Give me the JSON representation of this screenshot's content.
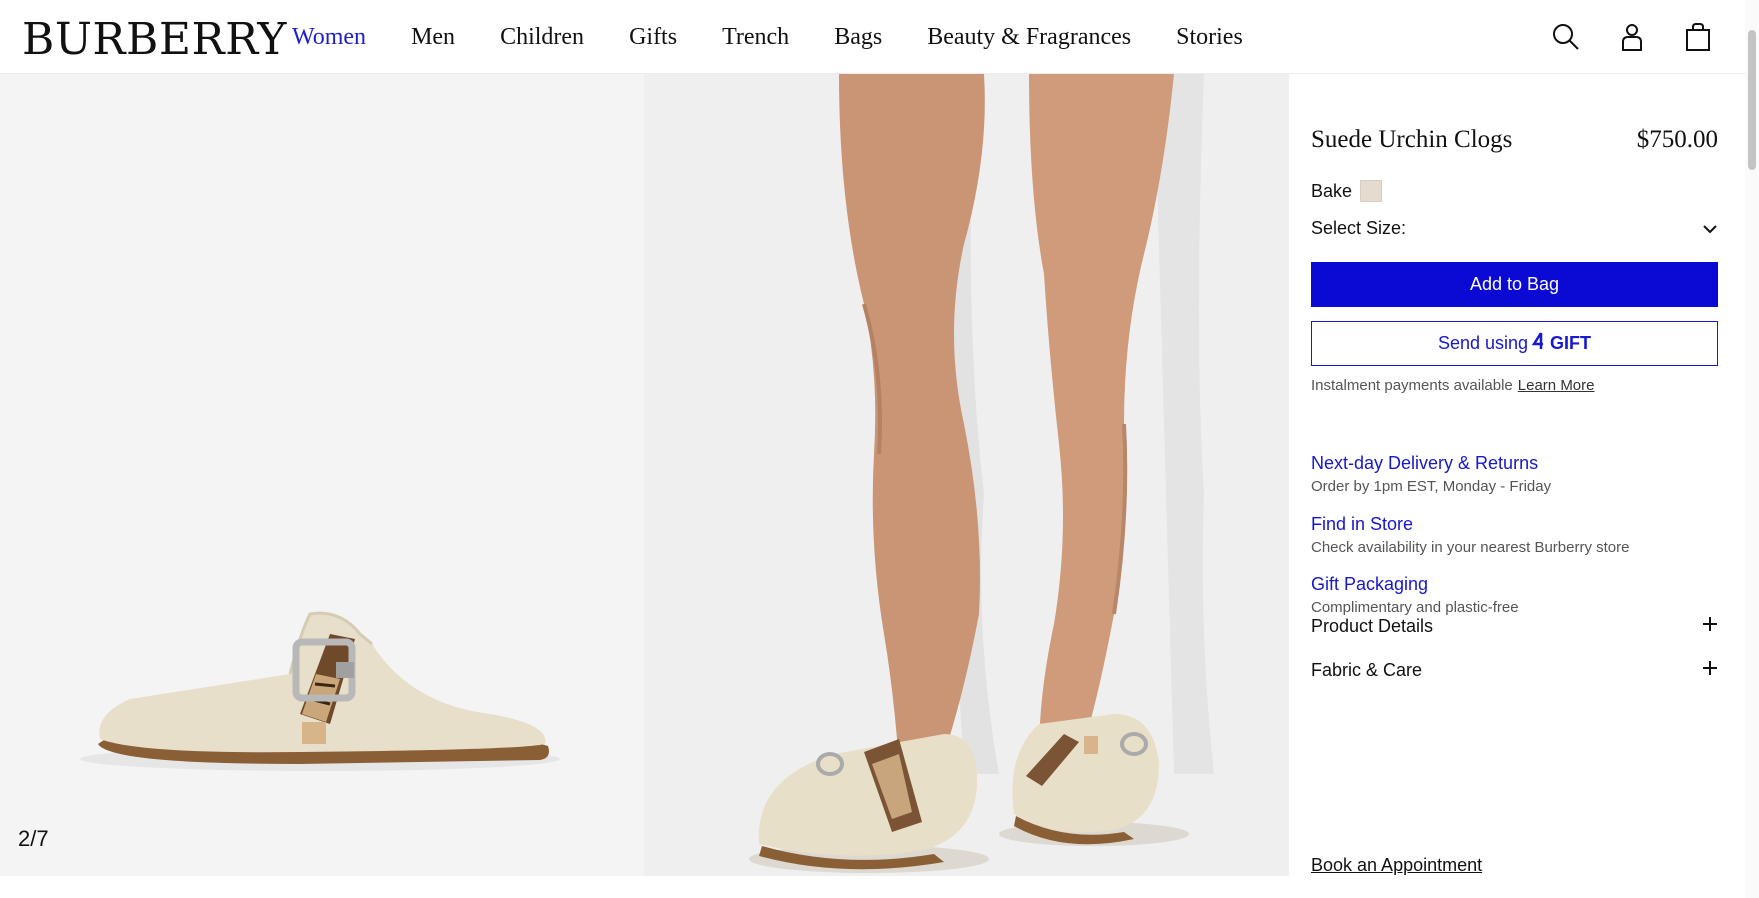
{
  "header": {
    "logo": "BURBERRY",
    "nav": [
      {
        "label": "Women",
        "active": true
      },
      {
        "label": "Men"
      },
      {
        "label": "Children"
      },
      {
        "label": "Gifts"
      },
      {
        "label": "Trench"
      },
      {
        "label": "Bags"
      },
      {
        "label": "Beauty & Fragrances"
      },
      {
        "label": "Stories"
      }
    ],
    "icons": [
      "search-icon",
      "account-icon",
      "shopping-bag-icon"
    ]
  },
  "gallery": {
    "counter": "2/7"
  },
  "product": {
    "title": "Suede Urchin Clogs",
    "price": "$750.00",
    "color_name": "Bake",
    "color_hex": "#e5dcd0",
    "size_label": "Select Size:",
    "add_to_bag": "Add to Bag",
    "send_using": "Send using",
    "gift_brand": "GIFT",
    "instalment_text": "Instalment payments available",
    "learn_more": "Learn More"
  },
  "services": [
    {
      "title": "Next-day Delivery & Returns",
      "subtitle": "Order by 1pm EST, Monday - Friday"
    },
    {
      "title": "Find in Store",
      "subtitle": "Check availability in your nearest Burberry store"
    },
    {
      "title": "Gift Packaging",
      "subtitle": "Complimentary and plastic-free"
    }
  ],
  "accordion": [
    {
      "label": "Product Details"
    },
    {
      "label": "Fabric & Care"
    }
  ],
  "book_appointment": "Book an Appointment",
  "colors": {
    "accent": "#0a0ad4",
    "link": "#1818cc"
  }
}
